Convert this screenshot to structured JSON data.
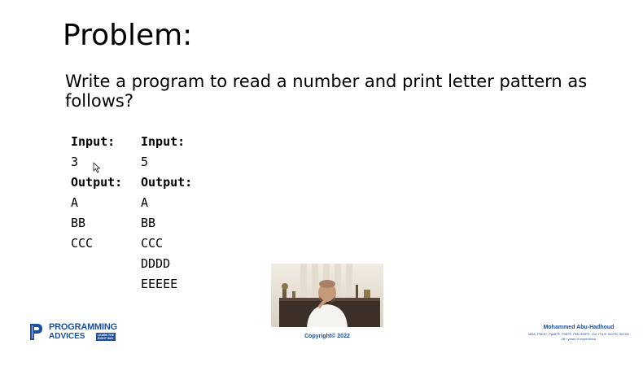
{
  "title": "Problem:",
  "question": "Write a program to read a number and print letter pattern as follows?",
  "examples": [
    {
      "input_label": "Input:",
      "input_value": "3",
      "output_label": "Output:",
      "output_lines": [
        "A",
        "BB",
        "CCC"
      ]
    },
    {
      "input_label": "Input:",
      "input_value": "5",
      "output_label": "Output:",
      "output_lines": [
        "A",
        "BB",
        "CCC",
        "DDDD",
        "EEEEE"
      ]
    }
  ],
  "copyright": "Copyright© 2022",
  "logo": {
    "line1": "PROGRAMMING",
    "line2": "ADVICES",
    "tagline": "LEARN THE\nRIGHT WAY",
    "color": "#1c4fa0"
  },
  "author": {
    "name": "Mohammed Abu-Hadhoud",
    "certs": "MBA, PMOC, PgMP®, PMP®, PMI-RMP®, CM, ITIL®, MCPD, MCSD",
    "experience": "26+ years of experience"
  },
  "icons": {
    "cursor": "mouse-pointer-icon",
    "logo": "programming-advices-logo-icon"
  }
}
